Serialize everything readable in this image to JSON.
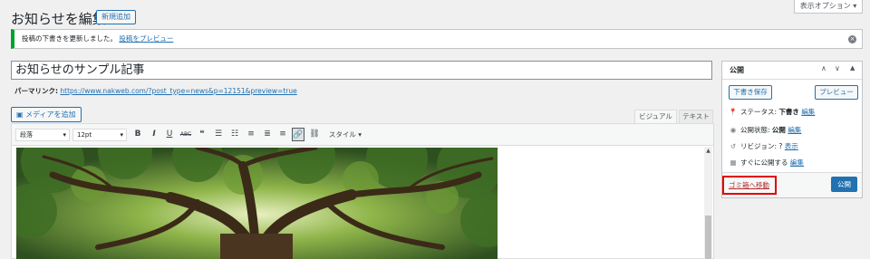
{
  "header": {
    "title": "お知らせを編集",
    "add_new": "新規追加",
    "screen_options": "表示オプション ▾"
  },
  "notice": {
    "text": "投稿の下書きを更新しました。",
    "link": "投稿をプレビュー"
  },
  "post": {
    "title": "お知らせのサンプル記事",
    "permalink_label": "パーマリンク:",
    "permalink_url": "https://www.nakweb.com/?post_type=news&p=12151&preview=true"
  },
  "editor": {
    "media_button": "メディアを追加",
    "tab_visual": "ビジュアル",
    "tab_text": "テキスト",
    "format_select": "段落",
    "size_select": "12pt",
    "style_label": "スタイル ▾"
  },
  "publish_box": {
    "title": "公開",
    "save_draft": "下書き保存",
    "preview": "プレビュー",
    "status_label": "ステータス:",
    "status_value": "下書き",
    "status_edit": "編集",
    "visibility_label": "公開状態:",
    "visibility_value": "公開",
    "visibility_edit": "編集",
    "revisions_label": "リビジョン: ?",
    "revisions_link": "表示",
    "schedule_label": "すぐに公開する",
    "schedule_edit": "編集",
    "trash": "ゴミ箱へ移動",
    "publish": "公開"
  },
  "colors": {
    "accent": "#2271b1",
    "highlight": "#e00000",
    "notice_border": "#00a32a"
  }
}
